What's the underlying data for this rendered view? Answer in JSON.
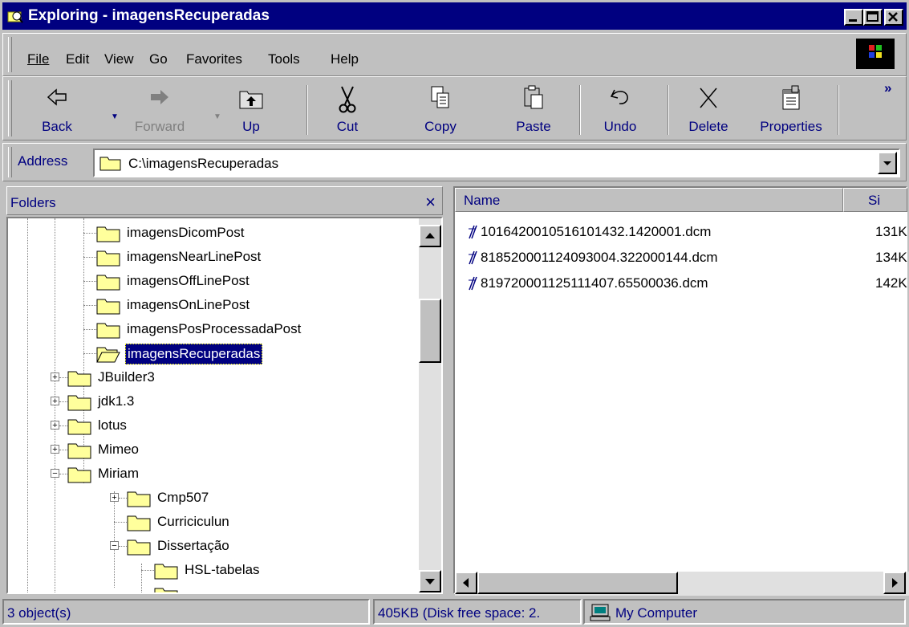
{
  "window": {
    "title": "Exploring - imagensRecuperadas"
  },
  "menu": {
    "items": [
      {
        "label": "File",
        "key": "F"
      },
      {
        "label": "Edit",
        "key": "E"
      },
      {
        "label": "View",
        "key": "V"
      },
      {
        "label": "Go",
        "key": "G"
      },
      {
        "label": "Favorites",
        "key": "a"
      },
      {
        "label": "Tools",
        "key": "T"
      },
      {
        "label": "Help",
        "key": "H"
      }
    ]
  },
  "toolbar": {
    "back": "Back",
    "forward": "Forward",
    "up": "Up",
    "cut": "Cut",
    "copy": "Copy",
    "paste": "Paste",
    "undo": "Undo",
    "delete": "Delete",
    "properties": "Properties",
    "more": "»"
  },
  "address": {
    "label": "Address",
    "value": "C:\\imagensRecuperadas"
  },
  "folders": {
    "header": "Folders",
    "close": "×",
    "items": [
      {
        "label": "imagensDicomPost"
      },
      {
        "label": "imagensNearLinePost"
      },
      {
        "label": "imagensOffLinePost"
      },
      {
        "label": "imagensOnLinePost"
      },
      {
        "label": "imagensPosProcessadaPost"
      },
      {
        "label": "imagensRecuperadas"
      },
      {
        "label": "JBuilder3"
      },
      {
        "label": "jdk1.3"
      },
      {
        "label": "lotus"
      },
      {
        "label": "Mimeo"
      },
      {
        "label": "Miriam"
      },
      {
        "label": "Cmp507"
      },
      {
        "label": "Curriciculun"
      },
      {
        "label": "Dissertação"
      },
      {
        "label": "HSL-tabelas"
      }
    ]
  },
  "files": {
    "columns": {
      "name": "Name",
      "size": "Si"
    },
    "rows": [
      {
        "name": "1016420010516101432.1420001.dcm",
        "size": "131K"
      },
      {
        "name": "818520001124093004.322000144.dcm",
        "size": "134K"
      },
      {
        "name": "819720001125111407.65500036.dcm",
        "size": "142K"
      }
    ]
  },
  "status": {
    "objects": "3 object(s)",
    "size": "405KB (Disk free space: 2.",
    "location": "My Computer"
  },
  "colors": {
    "titlebar": "#000080",
    "face": "#c0c0c0",
    "selection": "#000080"
  }
}
